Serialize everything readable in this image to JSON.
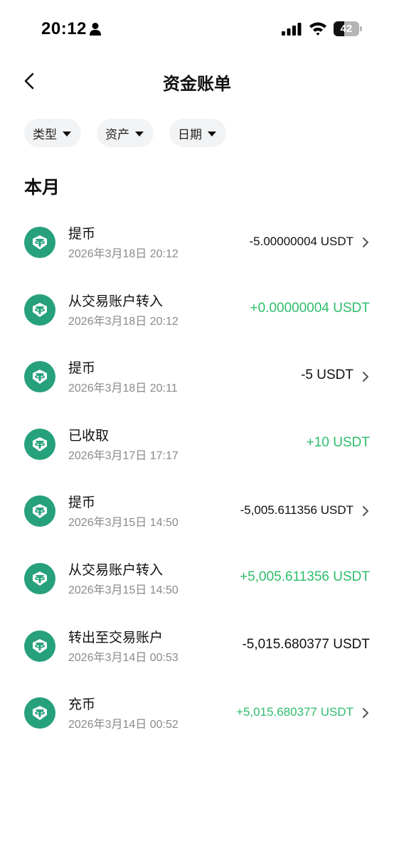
{
  "status_bar": {
    "time": "20:12",
    "battery": 42
  },
  "header": {
    "title": "资金账单"
  },
  "filters": [
    {
      "label": "类型"
    },
    {
      "label": "资产"
    },
    {
      "label": "日期"
    }
  ],
  "section": {
    "title": "本月"
  },
  "transactions": [
    {
      "type": "提币",
      "time": "2026年3月18日 20:12",
      "amount": "-5.00000004 USDT",
      "direction": "negative",
      "has_chevron": true
    },
    {
      "type": "从交易账户转入",
      "time": "2026年3月18日 20:12",
      "amount": "+0.00000004 USDT",
      "direction": "positive",
      "has_chevron": false
    },
    {
      "type": "提币",
      "time": "2026年3月18日 20:11",
      "amount": "-5 USDT",
      "direction": "negative",
      "has_chevron": true
    },
    {
      "type": "已收取",
      "time": "2026年3月17日 17:17",
      "amount": "+10 USDT",
      "direction": "positive",
      "has_chevron": false
    },
    {
      "type": "提币",
      "time": "2026年3月15日 14:50",
      "amount": "-5,005.611356 USDT",
      "direction": "negative",
      "has_chevron": true
    },
    {
      "type": "从交易账户转入",
      "time": "2026年3月15日 14:50",
      "amount": "+5,005.611356 USDT",
      "direction": "positive",
      "has_chevron": false
    },
    {
      "type": "转出至交易账户",
      "time": "2026年3月14日 00:53",
      "amount": "-5,015.680377 USDT",
      "direction": "negative",
      "has_chevron": false
    },
    {
      "type": "充币",
      "time": "2026年3月14日 00:52",
      "amount": "+5,015.680377 USDT",
      "direction": "positive",
      "has_chevron": true
    }
  ],
  "colors": {
    "positive": "#2ebd6b",
    "negative": "#111111",
    "usdt_brand": "#26a17b"
  },
  "icons": {
    "coin": "tether-usdt-icon",
    "back": "back-arrow-icon",
    "chevron": "chevron-right-icon"
  }
}
